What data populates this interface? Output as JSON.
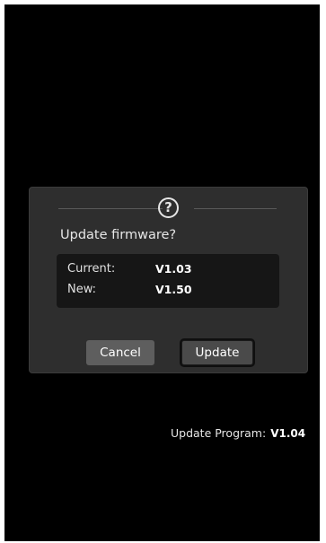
{
  "dialog": {
    "icon": "question-mark-circle-icon",
    "help_glyph": "?",
    "title": "Update firmware?",
    "current_label": "Current:",
    "current_value": "V1.03",
    "new_label": "New:",
    "new_value": "V1.50",
    "cancel_label": "Cancel",
    "update_label": "Update"
  },
  "status": {
    "program_label": "Update Program:",
    "program_version": "V1.04"
  },
  "colors": {
    "background": "#000000",
    "dialog": "#2e2e2e",
    "info_box": "#161616",
    "cancel_button": "#5e5e5e",
    "update_button": "#4a4a4a",
    "text": "#e6e6e6"
  }
}
